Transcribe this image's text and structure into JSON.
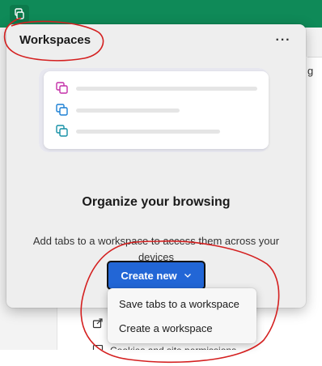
{
  "topbar": {
    "icon": "workspaces-icon",
    "color": "#0f8a58"
  },
  "backdrop": {
    "tab_text": "g",
    "row1_icon": "share-icon",
    "row2_text": "Cookies and site permissions",
    "row2_icon": "cookie-icon"
  },
  "flyout": {
    "title": "Workspaces",
    "more_icon": "more-icon",
    "more_label": "···",
    "illustration_icons": [
      "workspace-icon-pink",
      "workspace-icon-blue",
      "workspace-icon-teal"
    ],
    "heading": "Organize your browsing",
    "description": "Add tabs to a workspace to access them across your devices",
    "create_label": "Create new",
    "create_icon": "chevron-down-icon",
    "accent": "#2266d6"
  },
  "menu": {
    "items": [
      {
        "label": "Save tabs to a workspace"
      },
      {
        "label": "Create a workspace"
      }
    ]
  },
  "annotation_color": "#d42020"
}
